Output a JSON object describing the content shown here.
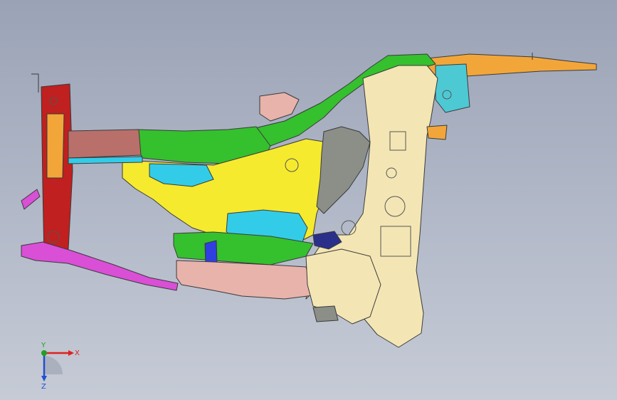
{
  "viewport": {
    "background_top": "#9aa3b6",
    "background_bottom": "#c6cbd6"
  },
  "model": {
    "description_icon": "car-body-side-structure-assembly",
    "colors": {
      "red": "#c0201f",
      "orange": "#f2a63a",
      "brown": "#b9706a",
      "green": "#35c02e",
      "yellow": "#f5ea2e",
      "cream": "#f3e6b4",
      "cyan": "#33cce8",
      "blue": "#2f3fe0",
      "magenta": "#d94fd6",
      "pink": "#e8b3ab",
      "gray": "#8b8f88",
      "teal": "#4dc9d4"
    }
  },
  "triad": {
    "x_label": "X",
    "y_label": "Y",
    "z_label": "Z",
    "x_color": "#e02020",
    "y_color": "#20a020",
    "z_color": "#2050d0"
  }
}
